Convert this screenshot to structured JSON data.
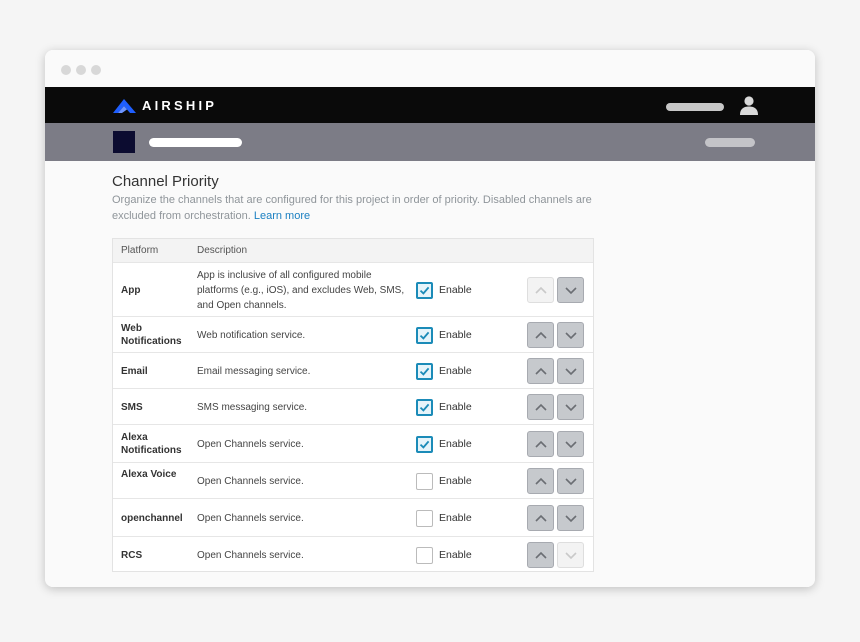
{
  "app": {
    "brand": "AIRSHIP"
  },
  "page": {
    "title": "Channel Priority",
    "description": "Organize the channels that are configured for this project in order of priority. Disabled channels are excluded from orchestration.",
    "learn_more": "Learn more"
  },
  "table": {
    "headers": {
      "platform": "Platform",
      "description": "Description"
    },
    "rows": [
      {
        "platform": "App",
        "description": "App is inclusive of all configured mobile platforms (e.g., iOS), and excludes Web, SMS, and Open channels.",
        "enabled": true,
        "enable_label": "Enable",
        "up_enabled": false,
        "down_enabled": true
      },
      {
        "platform": "Web Notifications",
        "description": "Web notification service.",
        "enabled": true,
        "enable_label": "Enable",
        "up_enabled": true,
        "down_enabled": true
      },
      {
        "platform": "Email",
        "description": "Email messaging service.",
        "enabled": true,
        "enable_label": "Enable",
        "up_enabled": true,
        "down_enabled": true
      },
      {
        "platform": "SMS",
        "description": "SMS messaging service.",
        "enabled": true,
        "enable_label": "Enable",
        "up_enabled": true,
        "down_enabled": true
      },
      {
        "platform": "Alexa Notifications",
        "description": "Open Channels service.",
        "enabled": true,
        "enable_label": "Enable",
        "up_enabled": true,
        "down_enabled": true
      },
      {
        "platform": "Alexa Voice",
        "description": "Open Channels service.",
        "enabled": false,
        "enable_label": "Enable",
        "up_enabled": true,
        "down_enabled": true
      },
      {
        "platform": "openchannel",
        "description": "Open Channels service.",
        "enabled": false,
        "enable_label": "Enable",
        "up_enabled": true,
        "down_enabled": true
      },
      {
        "platform": "RCS",
        "description": "Open Channels service.",
        "enabled": false,
        "enable_label": "Enable",
        "up_enabled": true,
        "down_enabled": false
      }
    ]
  },
  "icons": {
    "logo": "airship-logo-icon",
    "user": "user-icon",
    "check": "check-icon",
    "up": "chevron-up-icon",
    "down": "chevron-down-icon"
  },
  "colors": {
    "nav_bg": "#0a0a0a",
    "subnav_bg": "#7c7c86",
    "brand_blue": "#1f5fff",
    "check_blue": "#1b8bb8",
    "link": "#1a7fc1"
  }
}
